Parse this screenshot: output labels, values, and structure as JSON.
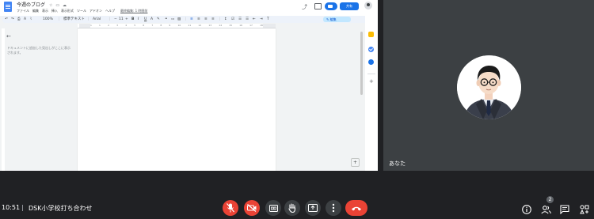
{
  "docs": {
    "title": "今週のブログ",
    "menus": [
      "ファイル",
      "編集",
      "表示",
      "挿入",
      "表示形式",
      "ツール",
      "アドオン",
      "ヘルプ"
    ],
    "last_edit": "最終編集: 1 時間前",
    "share_label": "共有",
    "toolbar": {
      "zoom": "100%",
      "style": "標準テキスト",
      "font": "Arial",
      "font_size": "11",
      "edit_mode": "編集"
    },
    "ruler_numbers": [
      "1",
      "1",
      "2",
      "3",
      "4",
      "5",
      "6",
      "7",
      "8",
      "9",
      "10",
      "11",
      "12",
      "13",
      "14",
      "15",
      "16",
      "17",
      "18"
    ],
    "outline_hint": "ドキュメントに追加した見出しがここに表示されます。"
  },
  "tile": {
    "participant_name": "あなた"
  },
  "meeting": {
    "time": "10:51",
    "separator": "|",
    "name": "DSK小学校打ち合わせ",
    "participant_count": "2"
  },
  "colors": {
    "meet_background": "#202124",
    "tile_background": "#3c4043",
    "hangup_red": "#ea4335",
    "docs_blue": "#1a73e8"
  }
}
